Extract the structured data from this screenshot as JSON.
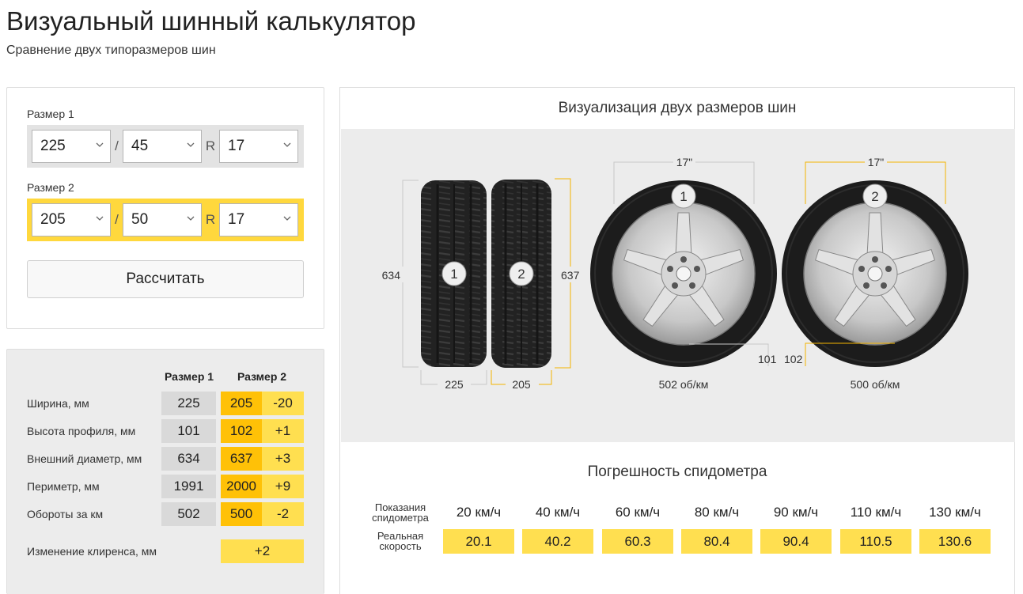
{
  "header": {
    "title": "Визуальный шинный калькулятор",
    "subtitle": "Сравнение двух типоразмеров шин"
  },
  "form": {
    "size1": {
      "label": "Размер 1",
      "width": "225",
      "profile": "45",
      "rim": "17"
    },
    "size2": {
      "label": "Размер 2",
      "width": "205",
      "profile": "50",
      "rim": "17"
    },
    "slash": "/",
    "r": "R",
    "calculate_label": "Рассчитать"
  },
  "results": {
    "col1": "Размер 1",
    "col2": "Размер 2",
    "rows": [
      {
        "label": "Ширина, мм",
        "v1": "225",
        "v2": "205",
        "diff": "-20"
      },
      {
        "label": "Высота профиля, мм",
        "v1": "101",
        "v2": "102",
        "diff": "+1"
      },
      {
        "label": "Внешний диаметр, мм",
        "v1": "634",
        "v2": "637",
        "diff": "+3"
      },
      {
        "label": "Периметр, мм",
        "v1": "1991",
        "v2": "2000",
        "diff": "+9"
      },
      {
        "label": "Обороты за км",
        "v1": "502",
        "v2": "500",
        "diff": "-2"
      }
    ],
    "clearance_label": "Изменение клиренса, мм",
    "clearance_value": "+2"
  },
  "visualization": {
    "title": "Визуализация двух размеров шин",
    "side": {
      "badge1": "1",
      "badge2": "2",
      "height1": "634",
      "height2": "637",
      "width1": "225",
      "width2": "205"
    },
    "wheel1": {
      "badge": "1",
      "rim": "17\"",
      "profile": "101",
      "rpm": "502 об/км"
    },
    "wheel2": {
      "badge": "2",
      "rim": "17\"",
      "profile": "102",
      "rpm": "500 об/км"
    },
    "colors": {
      "size1_lines": "#c8c8c8",
      "size2_lines": "#f5b400",
      "accent": "#ffdf50"
    }
  },
  "speedometer": {
    "title": "Погрешность спидометра",
    "row1_label": "Показания спидометра",
    "row2_label": "Реальная скорость",
    "readings": [
      "20 км/ч",
      "40 км/ч",
      "60 км/ч",
      "80 км/ч",
      "90 км/ч",
      "110 км/ч",
      "130 км/ч"
    ],
    "real": [
      "20.1",
      "40.2",
      "60.3",
      "80.4",
      "90.4",
      "110.5",
      "130.6"
    ]
  }
}
